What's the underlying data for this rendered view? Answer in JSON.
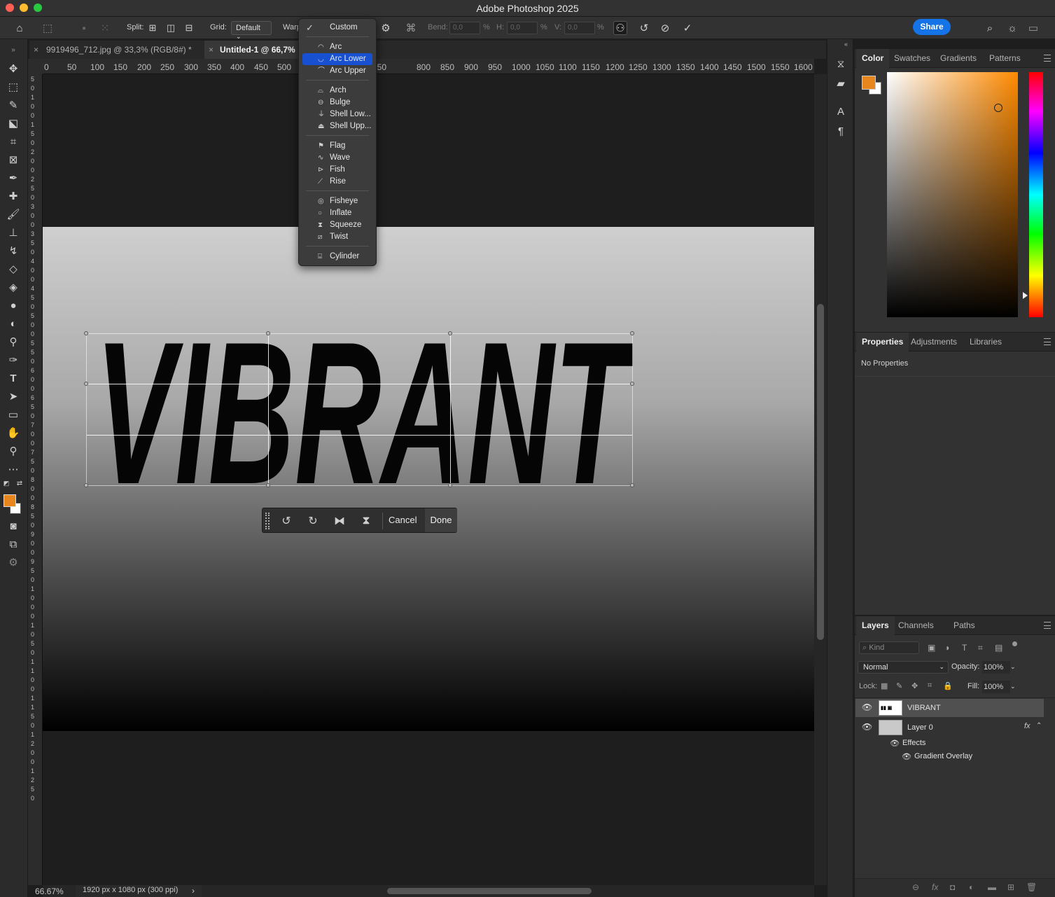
{
  "window": {
    "title": "Adobe Photoshop 2025"
  },
  "options": {
    "split_label": "Split:",
    "grid_label": "Grid:",
    "grid_value": "Default",
    "warp_label": "Warp",
    "bend_label": "Bend:",
    "bend_value": "0,0",
    "h_label": "H:",
    "h_value": "0,0",
    "v_label": "V:",
    "v_value": "0,0",
    "pct": "%",
    "share": "Share"
  },
  "tabs": [
    {
      "label": "9919496_712.jpg @ 33,3% (RGB/8#) *"
    },
    {
      "label": "Untitled-1 @ 66,7%"
    }
  ],
  "ruler_h": [
    "0",
    "50",
    "100",
    "150",
    "200",
    "250",
    "300",
    "350",
    "400",
    "450",
    "500",
    "750",
    "800",
    "850",
    "900",
    "950",
    "1000",
    "1050",
    "1100",
    "1150",
    "1200",
    "1250",
    "1300",
    "1350",
    "1400",
    "1450",
    "1500",
    "1550",
    "1600"
  ],
  "ruler_v": [
    "5",
    "0",
    "1",
    "0",
    "0",
    "1",
    "5",
    "0",
    "2",
    "0",
    "0",
    "2",
    "5",
    "0",
    "3",
    "0",
    "0",
    "3",
    "5",
    "0",
    "4",
    "0",
    "0",
    "4",
    "5",
    "0",
    "5",
    "0",
    "0",
    "5",
    "5",
    "0",
    "6",
    "0",
    "0",
    "6",
    "5",
    "0",
    "7",
    "0",
    "0",
    "7",
    "5",
    "0",
    "8",
    "0",
    "0",
    "8",
    "5",
    "0",
    "9",
    "0",
    "0",
    "9",
    "5",
    "0",
    "1",
    "0",
    "0",
    "0",
    "1",
    "0",
    "5",
    "0",
    "1",
    "1",
    "0",
    "0",
    "1",
    "1",
    "5",
    "0",
    "1",
    "2",
    "0",
    "0",
    "1",
    "2",
    "5",
    "0"
  ],
  "canvas": {
    "text": "VIBRANT"
  },
  "context_bar": {
    "cancel": "Cancel",
    "done": "Done"
  },
  "status": {
    "zoom": "66.67%",
    "doc_info": "1920 px x 1080 px (300 ppi)",
    "arrow": "›"
  },
  "warp_menu": {
    "items": [
      {
        "label": "Custom",
        "icon": "check-icon",
        "checked": true
      },
      {
        "label": "Arc",
        "icon": "arc-icon"
      },
      {
        "label": "Arc Lower",
        "icon": "arc-lower-icon",
        "selected": true
      },
      {
        "label": "Arc Upper",
        "icon": "arc-upper-icon"
      },
      {
        "label": "Arch",
        "icon": "arch-icon"
      },
      {
        "label": "Bulge",
        "icon": "bulge-icon"
      },
      {
        "label": "Shell Low...",
        "icon": "shell-lower-icon"
      },
      {
        "label": "Shell Upp...",
        "icon": "shell-upper-icon"
      },
      {
        "label": "Flag",
        "icon": "flag-icon"
      },
      {
        "label": "Wave",
        "icon": "wave-icon"
      },
      {
        "label": "Fish",
        "icon": "fish-icon"
      },
      {
        "label": "Rise",
        "icon": "rise-icon"
      },
      {
        "label": "Fisheye",
        "icon": "fisheye-icon"
      },
      {
        "label": "Inflate",
        "icon": "inflate-icon"
      },
      {
        "label": "Squeeze",
        "icon": "squeeze-icon"
      },
      {
        "label": "Twist",
        "icon": "twist-icon"
      },
      {
        "label": "Cylinder",
        "icon": "cylinder-icon"
      }
    ]
  },
  "color_panel": {
    "tabs": [
      "Color",
      "Swatches",
      "Gradients",
      "Patterns"
    ],
    "foreground": "#e8861e",
    "background": "#ffffff"
  },
  "properties_panel": {
    "tabs": [
      "Properties",
      "Adjustments",
      "Libraries"
    ],
    "empty_text": "No Properties"
  },
  "layers_panel": {
    "tabs": [
      "Layers",
      "Channels",
      "Paths"
    ],
    "kind": "Kind",
    "blend_mode": "Normal",
    "opacity_label": "Opacity:",
    "opacity_value": "100%",
    "lock_label": "Lock:",
    "fill_label": "Fill:",
    "fill_value": "100%",
    "layers": [
      {
        "name": "VIBRANT"
      },
      {
        "name": "Layer 0",
        "fx": "fx"
      }
    ],
    "effects_label": "Effects",
    "effect_name": "Gradient Overlay"
  }
}
